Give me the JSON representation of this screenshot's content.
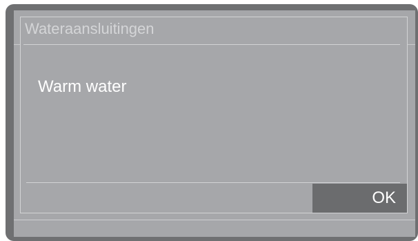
{
  "dialog": {
    "title": "Wateraansluitingen",
    "message": "Warm water",
    "ok_label": "OK"
  },
  "colors": {
    "bezel": "#6f7072",
    "screen": "#a6a7aa",
    "button": "#6b6c6e",
    "text": "#ffffff"
  }
}
